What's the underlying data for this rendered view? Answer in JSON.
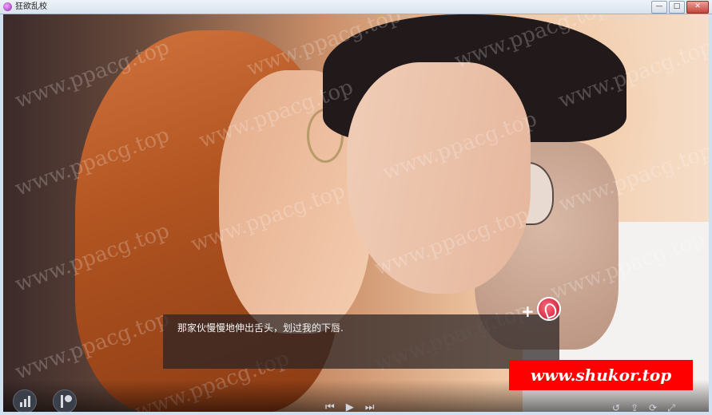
{
  "window": {
    "title": "狂欲乱校",
    "min_label": "—",
    "max_label": "□",
    "close_label": "✕"
  },
  "scene": {
    "watermark_text": "www.ppacg.top"
  },
  "dialog": {
    "text": "那家伙慢慢地伸出舌头，划过我的下唇."
  },
  "overlay": {
    "skip_plus": "+",
    "badge_icon": "flame-heart-icon",
    "site_banner": "www.shukor.top"
  },
  "controls": {
    "stats_icon": "bar-chart-icon",
    "patreon_icon": "patreon-icon",
    "media": {
      "prev": "⏮",
      "play": "▶",
      "skip": "⏭"
    },
    "right": {
      "rollback": "↺",
      "save": "⇪",
      "load": "⟳",
      "fullscreen": "⤢"
    }
  },
  "colors": {
    "banner": "#ff0000",
    "dialog_bg": "#282224"
  }
}
